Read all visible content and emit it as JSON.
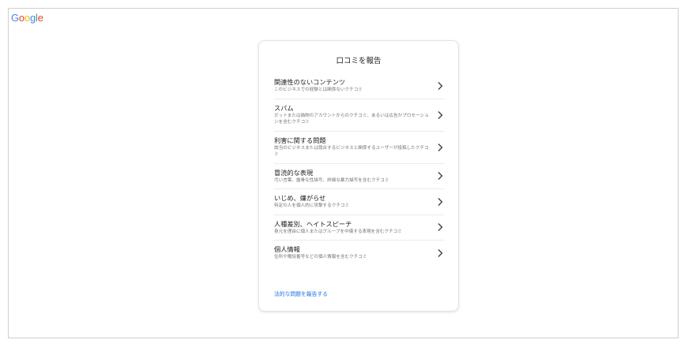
{
  "brand": {
    "logo_letters": [
      {
        "char": "G",
        "color": "#4285F4"
      },
      {
        "char": "o",
        "color": "#EA4335"
      },
      {
        "char": "o",
        "color": "#FBBC05"
      },
      {
        "char": "g",
        "color": "#4285F4"
      },
      {
        "char": "l",
        "color": "#34A853"
      },
      {
        "char": "e",
        "color": "#EA4335"
      }
    ]
  },
  "dialog": {
    "title": "口コミを報告",
    "items": [
      {
        "title": "関連性のないコンテンツ",
        "desc": "このビジネスでの経験とは関係ないクチコミ"
      },
      {
        "title": "スパム",
        "desc": "ボットまたは偽物のアカウントからのクチコミ、あるいは広告かプロモーションを含むクチコミ"
      },
      {
        "title": "利害に関する問題",
        "desc": "該当のビジネスまたは競合するビジネスと関係するユーザーが投稿したクチコミ"
      },
      {
        "title": "冒涜的な表現",
        "desc": "汚い言葉、露骨な性描写、詳細な暴力描写を含むクチコミ"
      },
      {
        "title": "いじめ、嫌がらせ",
        "desc": "特定の人を個人的に攻撃するクチコミ"
      },
      {
        "title": "人種差別、ヘイトスピーチ",
        "desc": "身元を理由に個人またはグループを中傷する表現を含むクチコミ"
      },
      {
        "title": "個人情報",
        "desc": "住所や電話番号などの個人情報を含むクチコミ"
      }
    ],
    "legal_link": "法的な問題を報告する"
  },
  "icons": {
    "item_arrow": "chevron-right-icon"
  },
  "colors": {
    "link": "#1a73e8",
    "title_text": "#202124",
    "secondary_text": "#70757a"
  }
}
